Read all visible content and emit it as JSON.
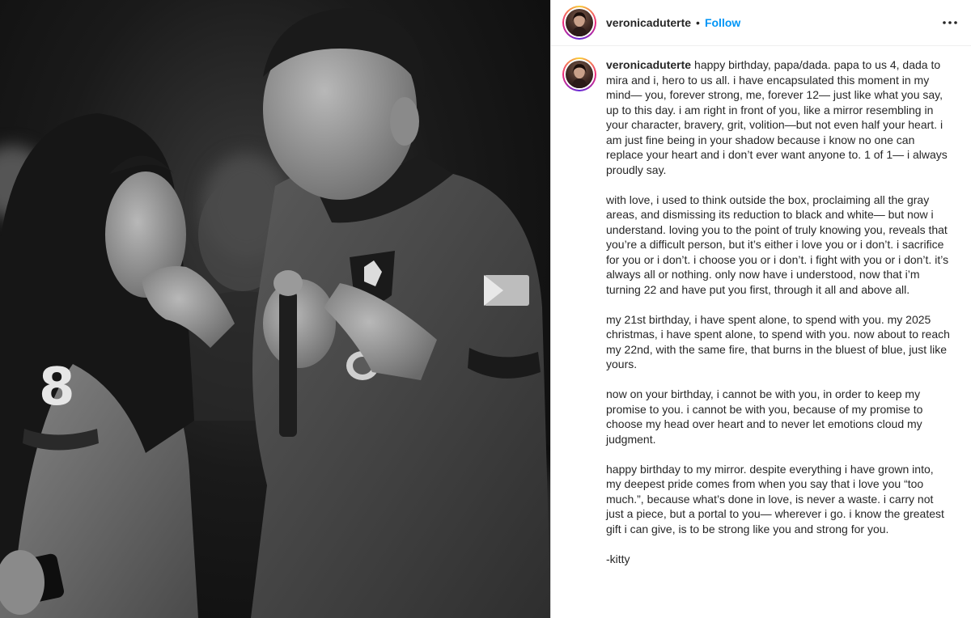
{
  "header": {
    "avatar_icon": "profile-avatar-icon",
    "username": "veronicaduterte",
    "separator": "•",
    "follow_label": "Follow",
    "more_icon": "more-options-icon"
  },
  "photo": {
    "alt_description_icon": "post-photo",
    "jersey_number": "8"
  },
  "caption": {
    "username": "veronicaduterte",
    "paragraphs": [
      "happy birthday, papa/dada. papa to us 4, dada to mira and i, hero to us all. i have encapsulated this moment in my mind— you, forever strong, me, forever 12— just like what you say, up to this day. i am right in front of you, like a mirror resembling in your character, bravery, grit, volition—but not even half your heart. i am just fine being in your shadow because i know no one can replace your heart and i don’t ever want anyone to. 1 of 1— i always proudly say.",
      "with love, i used to think outside the box, proclaiming all the gray areas, and dismissing its reduction to black and white— but now i understand. loving you to the point of truly knowing you, reveals that you’re a difficult person, but it’s either i love you or i don’t. i sacrifice for you or i don’t. i choose you or i don’t. i fight with you or i don’t. it’s always all or nothing. only now have i understood, now that i’m turning 22 and have put you first, through it all and above all.",
      "my 21st birthday, i have spent alone, to spend with you. my 2025 christmas, i have spent alone, to spend with you. now about to reach my 22nd, with the same fire, that burns in the bluest of blue, just like yours.",
      "now on your birthday, i cannot be with you, in order to keep my promise to you. i cannot be with you, because of my promise to choose my head over heart and to never let emotions cloud my judgment.",
      "happy birthday to my mirror. despite everything i have grown into, my deepest pride comes from when you say that i love you “too much.”, because what’s done in love, is never a waste. i carry not just a piece, but a portal to you— wherever i go. i know the greatest gift i can give, is to be strong like you and strong for you.",
      "-kitty"
    ]
  },
  "colors": {
    "follow": "#0095f6",
    "text": "#262626",
    "border": "#dbdbdb"
  }
}
